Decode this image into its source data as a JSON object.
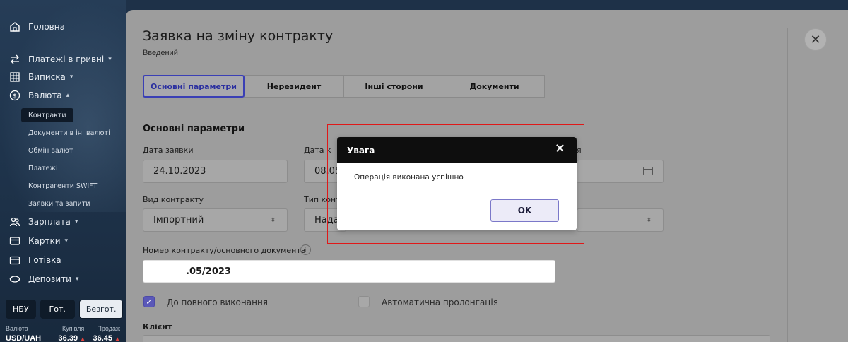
{
  "sidebar": {
    "nav": {
      "home": "Головна",
      "payments_uah": "Платежі в гривні",
      "statement": "Виписка",
      "currency": "Валюта",
      "salary": "Зарплата",
      "cards": "Картки",
      "cash": "Готівка",
      "deposits": "Депозити"
    },
    "currency_sub": [
      "Контракти",
      "Документи в ін. валюті",
      "Обмін валют",
      "Платежі",
      "Контрагенти SWIFT",
      "Заявки та запити"
    ],
    "rate_tabs": [
      "НБУ",
      "Гот.",
      "Безгот."
    ],
    "rate_header": {
      "currency": "Валюта",
      "buy": "Купівля",
      "sell": "Продаж"
    },
    "rate_row": {
      "pair": "USD/UAH",
      "buy": "36.39",
      "sell": "36.45"
    }
  },
  "page": {
    "title": "Заявка на зміну контракту",
    "status": "Введений",
    "close_icon": "close-icon",
    "tabs": [
      "Основні параметри",
      "Нерезидент",
      "Інші сторони",
      "Документи"
    ],
    "section_title": "Основні параметри",
    "labels": {
      "request_date": "Дата заявки",
      "contract_date": "Дата к",
      "third_date": "я",
      "contract_kind": "Вид контракту",
      "contract_type": "Тип конт",
      "contract_number": "Номер контракту/основного документа",
      "client": "Клієнт"
    },
    "values": {
      "request_date": "24.10.2023",
      "contract_date": "08.05",
      "contract_kind": "Імпортний",
      "contract_type": "Нада",
      "contract_number": ".05/2023"
    },
    "checkboxes": {
      "full_execution": "До повного виконання",
      "auto_prolongation": "Автоматична пролонгація"
    }
  },
  "modal": {
    "title": "Увага",
    "message": "Операція виконана успішно",
    "ok_label": "OK"
  }
}
